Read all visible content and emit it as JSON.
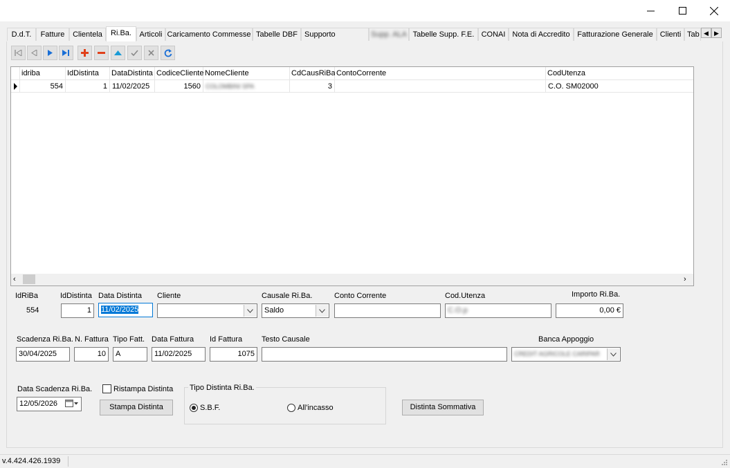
{
  "window": {
    "minimize": "—",
    "maximize": "☐",
    "close": "✕"
  },
  "tabs": [
    {
      "label": "D.d.T."
    },
    {
      "label": "Fatture"
    },
    {
      "label": "Clientela"
    },
    {
      "label": "Ri.Ba."
    },
    {
      "label": "Articoli"
    },
    {
      "label": "Caricamento Commesse"
    },
    {
      "label": "Tabelle DBF"
    },
    {
      "label": "Supporto"
    },
    {
      "label": "Supp. ALA"
    },
    {
      "label": "Tabelle Supp. F.E."
    },
    {
      "label": "CONAI"
    },
    {
      "label": "Nota di Accredito"
    },
    {
      "label": "Fatturazione Generale"
    },
    {
      "label": "Clienti"
    },
    {
      "label": "Tab"
    }
  ],
  "active_tab": "Ri.Ba.",
  "grid": {
    "columns": [
      "idriba",
      "IdDistinta",
      "DataDistinta",
      "CodiceCliente",
      "NomeCliente",
      "CdCausRiBa",
      "ContoCorrente",
      "CodUtenza"
    ],
    "rows": [
      {
        "idriba": "554",
        "IdDistinta": "1",
        "DataDistinta": "11/02/2025",
        "CodiceCliente": "1560",
        "NomeCliente": "COLOMBINI SPA",
        "CdCausRiBa": "3",
        "ContoCorrente": "",
        "CodUtenza": "C.O. SM02000"
      }
    ]
  },
  "form": {
    "idriba_label": "IdRiBa",
    "idriba_value": "554",
    "iddistinta_label": "IdDistinta",
    "iddistinta_value": "1",
    "data_distinta_label": "Data Distinta",
    "data_distinta_value": "11/02/2025",
    "cliente_label": "Cliente",
    "cliente_value": "",
    "causale_label": "Causale Ri.Ba.",
    "causale_value": "Saldo",
    "conto_corrente_label": "Conto Corrente",
    "conto_corrente_value": "",
    "cod_utenza_label": "Cod.Utenza",
    "cod_utenza_value": "C.O.p",
    "importo_label": "Importo Ri.Ba.",
    "importo_value": "0,00 €",
    "scadenza_label": "Scadenza Ri.Ba.",
    "scadenza_value": "30/04/2025",
    "n_fattura_label": "N. Fattura",
    "n_fattura_value": "10",
    "tipo_fatt_label": "Tipo Fatt.",
    "tipo_fatt_value": "A",
    "data_fattura_label": "Data Fattura",
    "data_fattura_value": "11/02/2025",
    "id_fattura_label": "Id Fattura",
    "id_fattura_value": "1075",
    "testo_causale_label": "Testo Causale",
    "testo_causale_value": "",
    "banca_label": "Banca Appoggio",
    "banca_value": "CREDIT AGRICOLE CARIPAR",
    "data_scadenza_label": "Data Scadenza Ri.Ba.",
    "data_scadenza_value": "12/05/2026",
    "ristampa_label": "Ristampa Distinta",
    "stampa_button": "Stampa Distinta",
    "tipo_distinta_label": "Tipo Distinta Ri.Ba.",
    "radio_sbf": "S.B.F.",
    "radio_allincasso": "All'incasso",
    "sommativa_button": "Distinta Sommativa"
  },
  "status": {
    "version": "v.4.424.426.1939"
  },
  "colors": {
    "nav_blue": "#1a6fd6",
    "nav_red": "#e0401a",
    "nav_teal": "#1a9bd6",
    "nav_gray": "#8a8a8a"
  }
}
